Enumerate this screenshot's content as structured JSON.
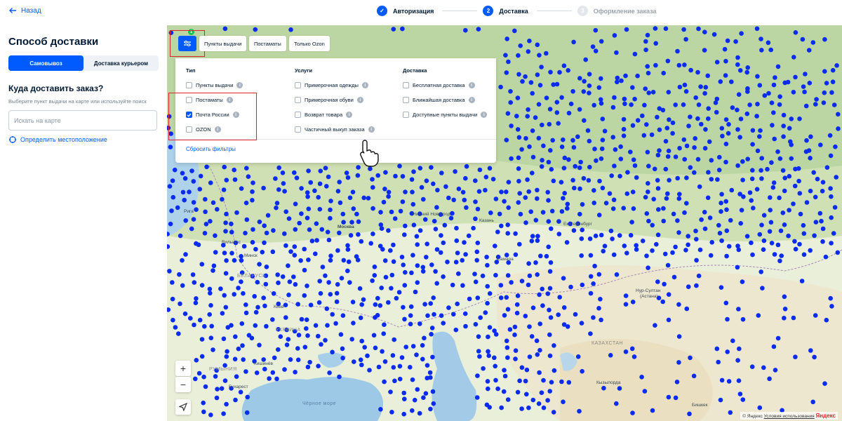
{
  "header": {
    "back_label": "Назад",
    "steps": [
      {
        "number": "1",
        "label": "Авторизация",
        "state": "done"
      },
      {
        "number": "2",
        "label": "Доставка",
        "state": "active"
      },
      {
        "number": "3",
        "label": "Оформление заказа",
        "state": "future"
      }
    ]
  },
  "sidebar": {
    "title": "Способ доставки",
    "tabs": {
      "pickup": "Самовывоз",
      "courier": "Доставка курьером",
      "selected": "pickup"
    },
    "where_title": "Куда доставить заказ?",
    "hint": "Выберите пункт выдачи на карте или используйте поиск",
    "search_placeholder": "Искать на карте",
    "locate_label": "Определить местоположение"
  },
  "map": {
    "filter_badge": "1",
    "chips": [
      "Пункты выдачи",
      "Постаматы",
      "Только Ozon"
    ],
    "filters": {
      "type_title": "Тип",
      "type_options": [
        {
          "label": "Пункты выдачи",
          "checked": false
        },
        {
          "label": "Постаматы",
          "checked": false
        },
        {
          "label": "Почта России",
          "checked": true
        },
        {
          "label": "OZON",
          "checked": false
        }
      ],
      "services_title": "Услуги",
      "services_options": [
        {
          "label": "Примерочная одежды",
          "checked": false
        },
        {
          "label": "Примерочная обуви",
          "checked": false
        },
        {
          "label": "Возврат товара",
          "checked": false
        },
        {
          "label": "Частичный выкуп заказа",
          "checked": false
        }
      ],
      "delivery_title": "Доставка",
      "delivery_options": [
        {
          "label": "Бесплатная доставка",
          "checked": false
        },
        {
          "label": "Ближайшая доставка",
          "checked": false
        },
        {
          "label": "Доступные пункты выдачи",
          "checked": false
        }
      ],
      "reset_label": "Сбросить фильтры"
    },
    "cities": [
      "Рига",
      "Вильнюс",
      "Минск",
      "Москва",
      "Киев",
      "Кишинёв",
      "Бухарест",
      "Нур-Султан",
      "(Астана)",
      "Бишкек",
      "Кызылорда",
      "Нижний Новгород",
      "Самара",
      "Казань",
      "Екатеринбург"
    ],
    "countries": [
      "БЕЛАРУСЬ",
      "УКРАИНА",
      "РУМЫНИЯ",
      "КАЗАХСТАН",
      "Чёрное море"
    ],
    "zoom_in": "+",
    "zoom_out": "−",
    "attribution": {
      "copyright": "© Яндекс",
      "terms": "Условия использования",
      "logo": "Яндекс"
    },
    "marker_color": "#0a2bf2"
  },
  "colors": {
    "accent": "#005bff",
    "badge": "#10c44c",
    "highlight": "#e0232c"
  }
}
